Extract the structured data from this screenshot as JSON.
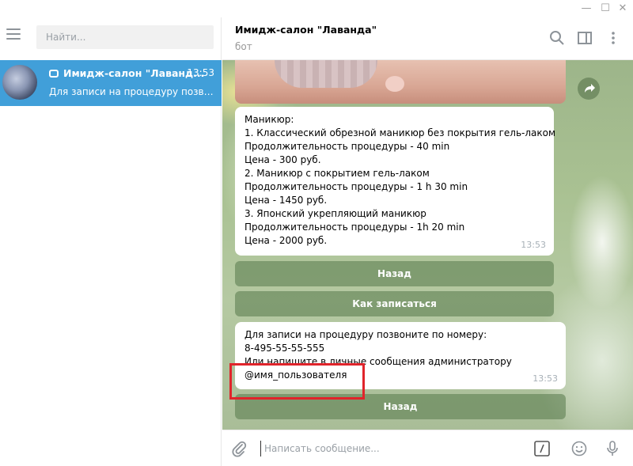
{
  "window": {
    "minimize": "—",
    "maximize": "☐",
    "close": "✕"
  },
  "sidebar": {
    "search_placeholder": "Найти...",
    "dialog": {
      "title": "Имидж-салон \"Лаванд...",
      "time": "13:53",
      "preview": "Для записи на процедуру позвонить по номеру..."
    }
  },
  "header": {
    "title": "Имидж-салон \"Лаванда\"",
    "subtitle": "бот"
  },
  "messages": [
    {
      "lines": [
        "Маникюр:",
        "1. Классический обрезной маникюр без покрытия гель-лаком",
        "Продолжительность процедуры - 40 min",
        "Цена - 300 руб.",
        "2. Маникюр с покрытием гель-лаком",
        "Продолжительность процедуры - 1 h 30 min",
        "Цена - 1450 руб.",
        "3. Японский укрепляющий маникюр",
        "Продолжительность процедуры - 1h 20 min",
        "Цена - 2000 руб."
      ],
      "time": "13:53",
      "buttons": [
        "Назад",
        "Как записаться"
      ]
    },
    {
      "lines": [
        "Для записи на процедуру позвоните по номеру:",
        "8-495-55-55-555",
        "Или напишите в личные сообщения администратору",
        "@имя_пользователя"
      ],
      "time": "13:53",
      "buttons": [
        "Назад"
      ]
    }
  ],
  "composer": {
    "placeholder": "Написать сообщение..."
  },
  "colors": {
    "accent": "#419fd9",
    "highlight": "#e0242b"
  }
}
